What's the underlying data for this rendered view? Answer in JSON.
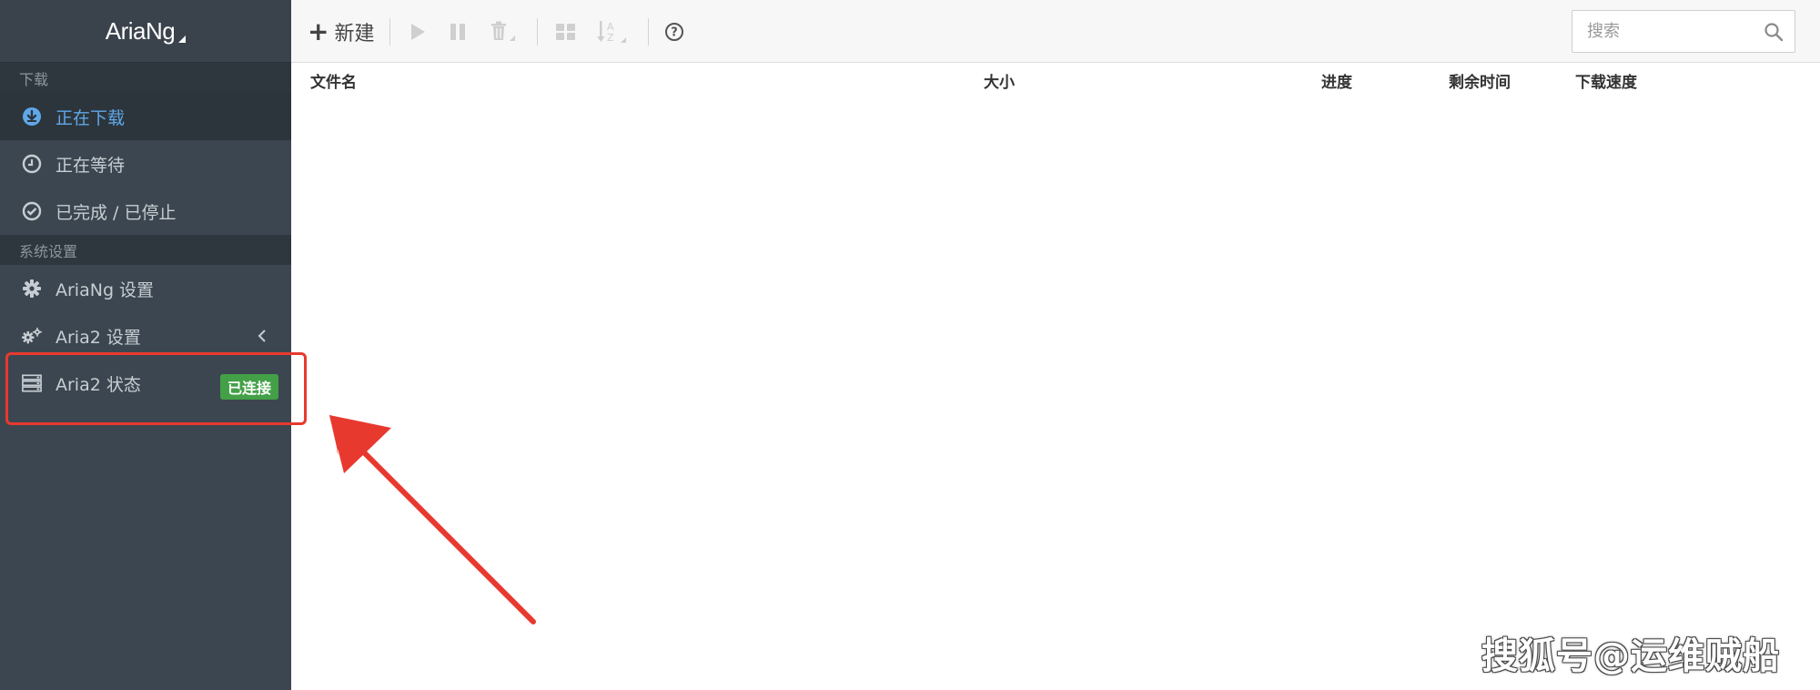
{
  "brand": {
    "name": "AriaNg"
  },
  "sidebar": {
    "download_section": "下载",
    "download_items": [
      {
        "label": "正在下载",
        "icon": "download-circle-icon",
        "active": true
      },
      {
        "label": "正在等待",
        "icon": "clock-icon",
        "active": false
      },
      {
        "label": "已完成 / 已停止",
        "icon": "check-circle-icon",
        "active": false
      }
    ],
    "settings_section": "系统设置",
    "settings_items": [
      {
        "label": "AriaNg 设置",
        "icon": "gear-icon"
      },
      {
        "label": "Aria2 设置",
        "icon": "gears-icon"
      },
      {
        "label": "Aria2 状态",
        "icon": "server-icon",
        "badge": "已连接"
      }
    ]
  },
  "toolbar": {
    "new_label": "新建",
    "search_placeholder": "搜索"
  },
  "table": {
    "columns": [
      "文件名",
      "大小",
      "进度",
      "剩余时间",
      "下载速度"
    ]
  },
  "colors": {
    "sidebar_bg": "#3c4650",
    "active_text": "#5fa8e8",
    "badge_bg": "#43a047",
    "annotation": "#e8392f"
  },
  "watermark": "搜狐号@运维贼船"
}
